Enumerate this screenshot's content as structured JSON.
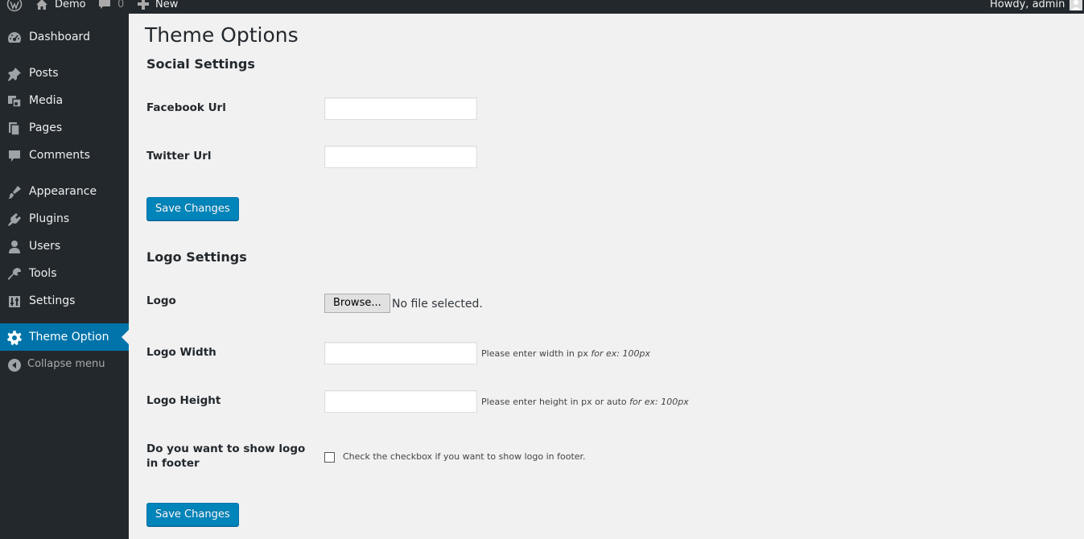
{
  "adminbar": {
    "site_name": "Demo",
    "comments_count": "0",
    "new_label": "New",
    "howdy": "Howdy, admin"
  },
  "sidebar": {
    "items": [
      {
        "label": "Dashboard",
        "icon": "dashboard-icon"
      },
      {
        "label": "Posts",
        "icon": "pin-icon"
      },
      {
        "label": "Media",
        "icon": "media-icon"
      },
      {
        "label": "Pages",
        "icon": "pages-icon"
      },
      {
        "label": "Comments",
        "icon": "comment-icon"
      },
      {
        "label": "Appearance",
        "icon": "brush-icon"
      },
      {
        "label": "Plugins",
        "icon": "plugin-icon"
      },
      {
        "label": "Users",
        "icon": "user-icon"
      },
      {
        "label": "Tools",
        "icon": "wrench-icon"
      },
      {
        "label": "Settings",
        "icon": "settings-icon"
      },
      {
        "label": "Theme Option",
        "icon": "gear-icon",
        "current": true
      }
    ],
    "collapse_label": "Collapse menu",
    "accent_color": "#0073aa",
    "background_color": "#23282d"
  },
  "main": {
    "title": "Theme Options",
    "social": {
      "heading": "Social Settings",
      "facebook_label": "Facebook Url",
      "facebook_value": "",
      "twitter_label": "Twitter Url",
      "twitter_value": "",
      "save_label": "Save Changes"
    },
    "logo": {
      "heading": "Logo Settings",
      "logo_label": "Logo",
      "browse_label": "Browse...",
      "file_status": "No file selected.",
      "width_label": "Logo Width",
      "width_value": "",
      "width_desc": "Please enter width in px",
      "width_example": "for ex: 100px",
      "height_label": "Logo Height",
      "height_value": "",
      "height_desc": "Please enter height in px or auto",
      "height_example": "for ex: 100px",
      "footer_label": "Do you want to show logo in footer",
      "footer_checked": false,
      "footer_desc": "Check the checkbox if you want to show logo in footer.",
      "save_label": "Save Changes"
    },
    "button_color": "#0085ba"
  }
}
